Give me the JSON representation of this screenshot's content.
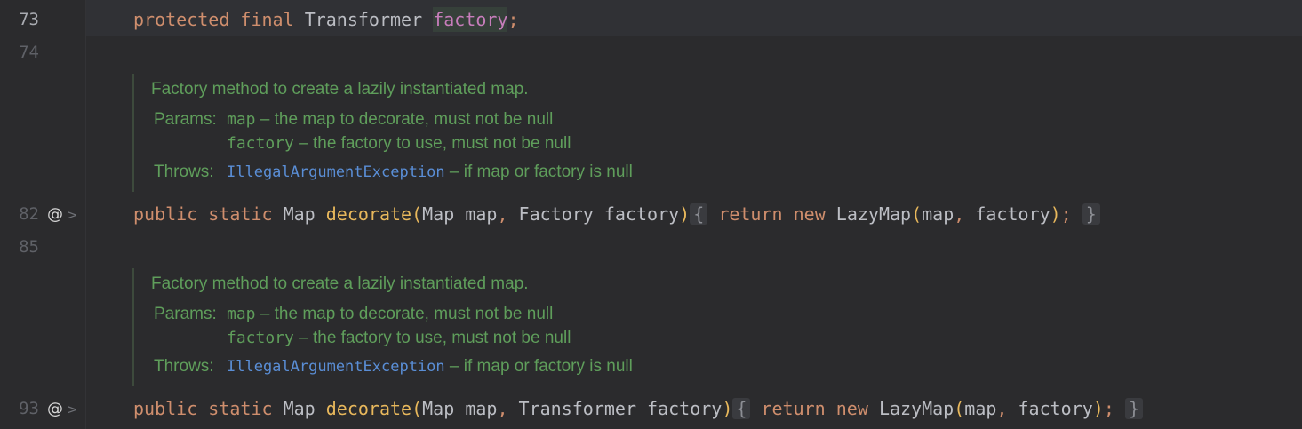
{
  "lines": {
    "l73": {
      "number": "73",
      "kw1": "protected",
      "kw2": "final",
      "type": "Transformer",
      "field": "factory",
      "semi": ";"
    },
    "l74": {
      "number": "74"
    },
    "l82": {
      "number": "82",
      "at_icon": "@",
      "chevron_icon": ">",
      "kw1": "public",
      "kw2": "static",
      "ret_type": "Map",
      "name": "decorate",
      "p1_type": "Map",
      "p1_name": "map",
      "p2_type": "Factory",
      "p2_name": "factory",
      "body_kw1": "return",
      "body_kw2": "new",
      "body_type": "LazyMap",
      "arg1": "map",
      "arg2": "factory"
    },
    "l85": {
      "number": "85"
    },
    "l93": {
      "number": "93",
      "at_icon": "@",
      "chevron_icon": ">",
      "kw1": "public",
      "kw2": "static",
      "ret_type": "Map",
      "name": "decorate",
      "p1_type": "Map",
      "p1_name": "map",
      "p2_type": "Transformer",
      "p2_name": "factory",
      "body_kw1": "return",
      "body_kw2": "new",
      "body_type": "LazyMap",
      "arg1": "map",
      "arg2": "factory"
    }
  },
  "docs": [
    {
      "description": "Factory method to create a lazily instantiated map.",
      "params_label": "Params:",
      "param1_name": "map",
      "param1_desc": " – the map to decorate, must not be null",
      "param2_name": "factory",
      "param2_desc": " – the factory to use, must not be null",
      "throws_label": "Throws:",
      "throws_type": "IllegalArgumentException",
      "throws_desc": " – if map or factory is null"
    },
    {
      "description": "Factory method to create a lazily instantiated map.",
      "params_label": "Params:",
      "param1_name": "map",
      "param1_desc": " – the map to decorate, must not be null",
      "param2_name": "factory",
      "param2_desc": " – the factory to use, must not be null",
      "throws_label": "Throws:",
      "throws_type": "IllegalArgumentException",
      "throws_desc": " – if map or factory is null"
    }
  ],
  "colors": {
    "background": "#2b2b2d",
    "keyword": "#cf8e6d",
    "method": "#e8b85c",
    "field": "#c77dbb",
    "doc_text": "#5f9e5b",
    "doc_link": "#5a8ed6"
  }
}
